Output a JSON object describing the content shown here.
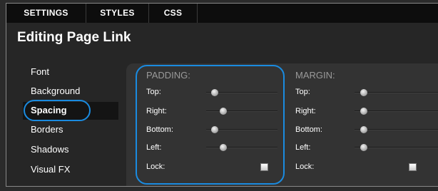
{
  "tabs": [
    {
      "label": "SETTINGS"
    },
    {
      "label": "STYLES"
    },
    {
      "label": "CSS"
    }
  ],
  "page_title": "Editing Page Link",
  "sidebar": {
    "items": [
      {
        "label": "Font"
      },
      {
        "label": "Background"
      },
      {
        "label": "Spacing"
      },
      {
        "label": "Borders"
      },
      {
        "label": "Shadows"
      },
      {
        "label": "Visual FX"
      }
    ],
    "active": "Spacing"
  },
  "padding": {
    "title": "PADDING:",
    "top_label": "Top:",
    "right_label": "Right:",
    "bottom_label": "Bottom:",
    "left_label": "Left:",
    "lock_label": "Lock:",
    "top_level": 0.08,
    "right_level": 0.22,
    "bottom_level": 0.08,
    "left_level": 0.22,
    "lock_checked": false
  },
  "margin": {
    "title": "MARGIN:",
    "top_label": "Top:",
    "right_label": "Right:",
    "bottom_label": "Bottom:",
    "left_label": "Left:",
    "lock_label": "Lock:",
    "top_level": 0.08,
    "right_level": 0.08,
    "bottom_level": 0.08,
    "left_level": 0.08,
    "lock_checked": false
  },
  "colors": {
    "accent": "#1a8be0",
    "tab_bar": "#0d0d0d",
    "panel": "#333333"
  }
}
